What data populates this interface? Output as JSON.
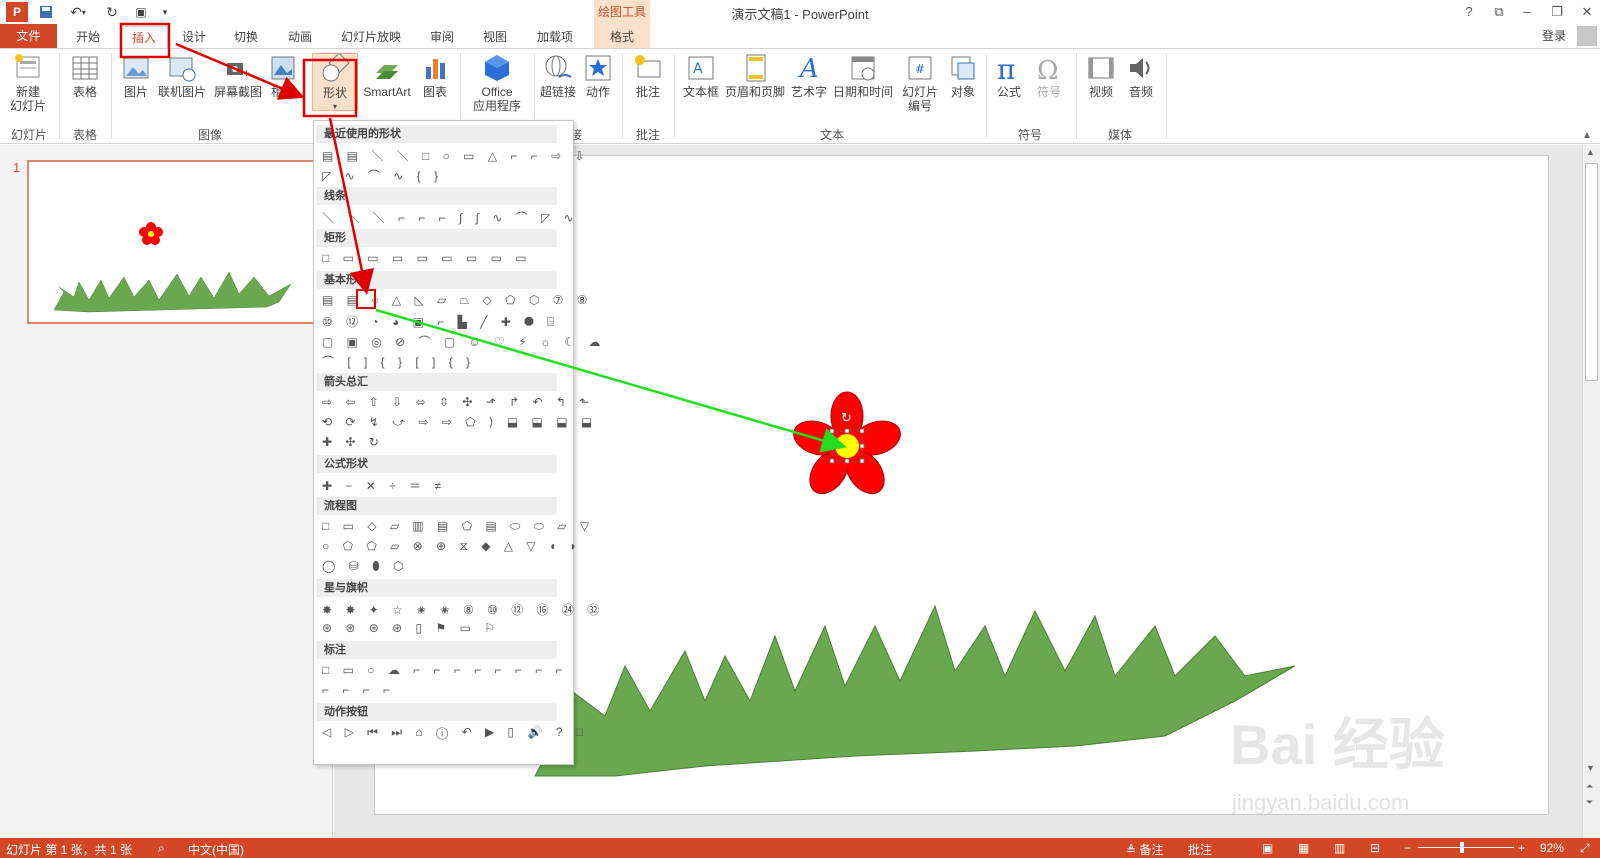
{
  "window": {
    "title": "演示文稿1 - PowerPoint",
    "contextual_tab_group": "绘图工具"
  },
  "window_controls": {
    "help": "?",
    "restore_ribbon": "⧉",
    "minimize": "–",
    "restore": "❐",
    "close": "✕"
  },
  "tabs": [
    {
      "label": "文件"
    },
    {
      "label": "开始"
    },
    {
      "label": "插入"
    },
    {
      "label": "设计"
    },
    {
      "label": "切换"
    },
    {
      "label": "动画"
    },
    {
      "label": "幻灯片放映"
    },
    {
      "label": "审阅"
    },
    {
      "label": "视图"
    },
    {
      "label": "加载项"
    },
    {
      "label": "格式"
    }
  ],
  "account": {
    "signin_label": "登录"
  },
  "ribbon": {
    "buttons": {
      "new_slide": "新建\n幻灯片",
      "table": "表格",
      "picture": "图片",
      "online_picture": "联机图片",
      "screenshot": "屏幕截图",
      "album": "相册",
      "shapes": "形状",
      "smartart": "SmartArt",
      "chart": "图表",
      "office_apps": "Office\n应用程序",
      "hyperlink": "超链接",
      "action": "动作",
      "comment": "批注",
      "textbox": "文本框",
      "header_footer": "页眉和页脚",
      "wordart": "艺术字",
      "datetime": "日期和时间",
      "slide_number": "幻灯片\n编号",
      "object": "对象",
      "equation": "公式",
      "symbol": "符号",
      "video": "视频",
      "audio": "音频"
    },
    "groups": {
      "slides": "幻灯片",
      "tables": "表格",
      "images": "图像",
      "links": "接",
      "comments": "批注",
      "text": "文本",
      "symbols": "符号",
      "media": "媒体"
    }
  },
  "gallery": {
    "sections": [
      {
        "title": "最近使用的形状",
        "rows": [
          "▤ ▤ ＼ ＼ □ ○ ▭ △ ⌐ ⌐ ⇨ ⇩",
          "◸ ∿ ⌒ ∿ { }"
        ]
      },
      {
        "title": "线条",
        "rows": [
          "＼ ＼ ＼ ⌐ ⌐ ⌐ ∫ ∫ ∿ ⌒ ◸ ∿"
        ]
      },
      {
        "title": "矩形",
        "rows": [
          "□ ▭ ▭ ▭ ▭ ▭ ▭ ▭ ▭"
        ]
      },
      {
        "title": "基本形状",
        "rows": [
          "▤ ▤ ○ △ ◺ ▱ ⏢ ◇ ⬠ ⬡ ⑦ ⑧",
          "⑩ ⑫ ◔ ◕ ▣ ⌐ ▙ ╱ ✚ ⯃ ⌸",
          "▢ ▣ ◎ ⊘ ⌒ ▢ ☺ ♡ ⚡ ☼ ☾ ☁",
          "⌒ [ ] { } [ ] { }"
        ]
      },
      {
        "title": "箭头总汇",
        "rows": [
          "⇨ ⇦ ⇧ ⇩ ⬄ ⇳ ✣ ⬏ ↱ ↶ ↰ ⬑",
          "⟲ ⟳ ↯ ⤻ ⇨ ⇨ ⬠ ⟩ ⬓ ⬓ ⬓ ⬓",
          "✚ ✣ ↻"
        ]
      },
      {
        "title": "公式形状",
        "rows": [
          "✚ − ✕ ÷ ＝ ≠"
        ]
      },
      {
        "title": "流程图",
        "rows": [
          "□ ▭ ◇ ▱ ▥ ▤ ⬠ ▤ ⬭ ⬭ ▱ ▽",
          "○ ⬠ ⬠ ▱ ⊗ ⊕ ⧖ ◆ △ ▽ ◖ ◗",
          "◯ ⛁ ⬮ ⬡"
        ]
      },
      {
        "title": "星与旗帜",
        "rows": [
          "✸ ✸ ✦ ☆ ✬ ✬ ⑧ ⑩ ⑫ ⑯ ㉔ ㉜",
          "⊛ ⊛ ⊛ ⊛ ▯ ⚑ ▭ ⚐"
        ]
      },
      {
        "title": "标注",
        "rows": [
          "□ ▭ ○ ☁ ⌐ ⌐ ⌐ ⌐ ⌐ ⌐ ⌐ ⌐",
          "⌐ ⌐ ⌐ ⌐"
        ]
      },
      {
        "title": "动作按钮",
        "rows": [
          "◁ ▷ ⏮ ⏭ ⌂ ⓘ ↶ ▶ ▯ 🔊 ? □"
        ]
      }
    ]
  },
  "thumbnail": {
    "number": "1"
  },
  "statusbar": {
    "slide_info": "幻灯片 第 1 张，共 1 张",
    "language": "中文(中国)",
    "notes": "≜ 备注",
    "comments": "批注",
    "zoom": "92%"
  },
  "colors": {
    "accent": "#d24726",
    "flower_red": "#ff0000",
    "flower_center": "#ffff00",
    "grass": "#6aa84f",
    "highlight_red": "#e00000",
    "arrow_green": "#22dd22"
  },
  "watermark": {
    "brand": "Bai 经验",
    "url": "jingyan.baidu.com"
  }
}
